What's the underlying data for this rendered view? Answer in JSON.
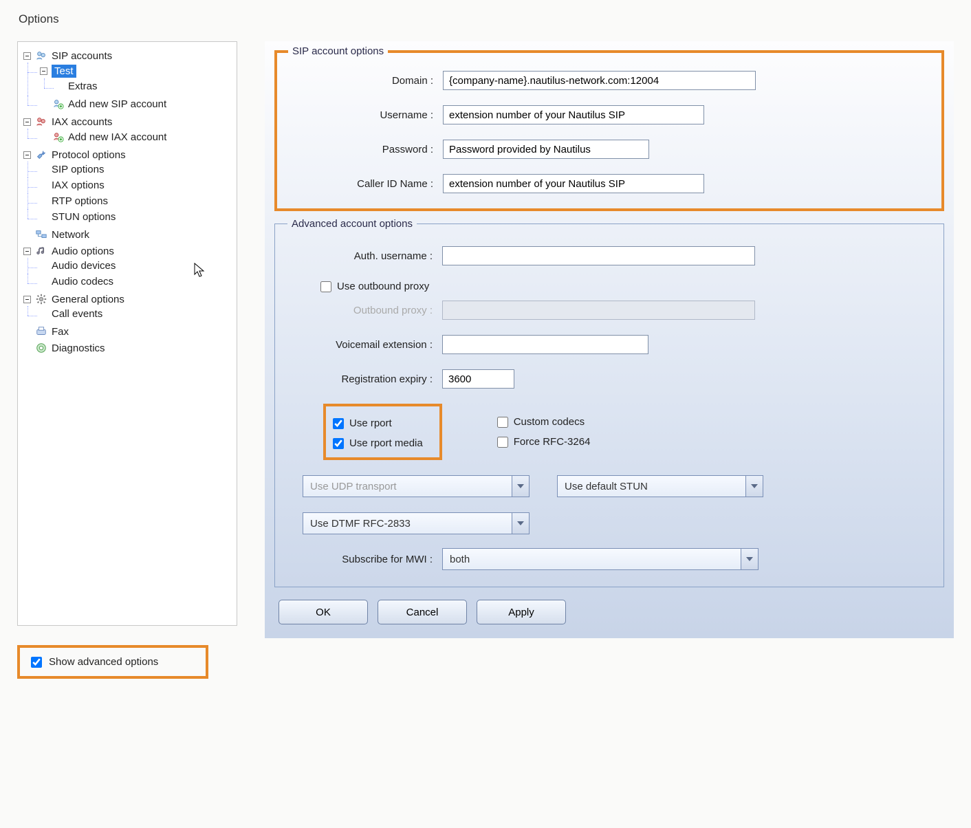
{
  "window_title": "Options",
  "tree": {
    "sip_accounts": "SIP accounts",
    "test": "Test",
    "extras": "Extras",
    "add_sip": "Add new SIP account",
    "iax_accounts": "IAX accounts",
    "add_iax": "Add new IAX account",
    "protocol_options": "Protocol options",
    "sip_options": "SIP options",
    "iax_options": "IAX options",
    "rtp_options": "RTP options",
    "stun_options": "STUN options",
    "network": "Network",
    "audio_options": "Audio options",
    "audio_devices": "Audio devices",
    "audio_codecs": "Audio codecs",
    "general_options": "General options",
    "call_events": "Call events",
    "fax": "Fax",
    "diagnostics": "Diagnostics"
  },
  "show_advanced": "Show advanced options",
  "sip_box": {
    "legend": "SIP account options",
    "domain_label": "Domain :",
    "domain_value": "{company-name}.nautilus-network.com:12004",
    "username_label": "Username :",
    "username_value": "extension number of your Nautilus SIP",
    "password_label": "Password :",
    "password_value": "Password provided by Nautilus",
    "callerid_label": "Caller ID Name :",
    "callerid_value": "extension number of your Nautilus SIP"
  },
  "adv_box": {
    "legend": "Advanced account options",
    "auth_user_label": "Auth. username :",
    "auth_user_value": "",
    "use_outbound_proxy": "Use outbound proxy",
    "outbound_proxy_label": "Outbound proxy :",
    "voicemail_label": "Voicemail extension :",
    "voicemail_value": "",
    "reg_expiry_label": "Registration expiry :",
    "reg_expiry_value": "3600",
    "use_rport": "Use rport",
    "use_rport_media": "Use rport media",
    "custom_codecs": "Custom codecs",
    "force_rfc": "Force RFC-3264",
    "transport_value": "Use UDP transport",
    "stun_value": "Use default STUN",
    "dtmf_value": "Use DTMF RFC-2833",
    "subscribe_mwi_label": "Subscribe for MWI :",
    "subscribe_mwi_value": "both"
  },
  "buttons": {
    "ok": "OK",
    "cancel": "Cancel",
    "apply": "Apply"
  }
}
